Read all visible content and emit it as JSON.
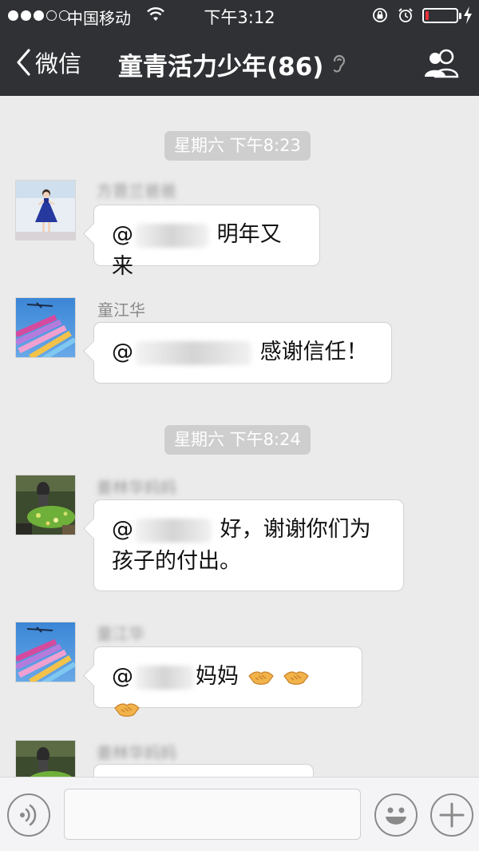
{
  "status_bar": {
    "carrier": "中国移动",
    "time": "下午3:12",
    "signal_bars_filled": 3,
    "signal_bars_total": 5,
    "battery_level": 0.1,
    "icons": [
      "wifi-icon",
      "rotation-lock-icon",
      "alarm-icon",
      "battery-icon",
      "charging-icon"
    ]
  },
  "nav": {
    "back_label": "微信",
    "title": "童青活力少年(86)",
    "ear_icon": "earpiece-mode-icon",
    "members_icon": "group-members-icon"
  },
  "chat": {
    "timestamps": [
      "星期六 下午8:23",
      "星期六 下午8:24"
    ],
    "messages": [
      {
        "sender": "方晋兰爸爸",
        "sender_obscured": true,
        "mention": "@童江华",
        "mention_obscured": true,
        "text": " 明年又来",
        "avatar": "girl-blue-dress-avatar"
      },
      {
        "sender": "童江华",
        "sender_obscured": false,
        "mention": "@方晋兰爸爸",
        "mention_obscured": true,
        "text": " 感谢信任！",
        "avatar": "airshow-jets-avatar"
      },
      {
        "sender": "姜林华妈妈",
        "sender_obscured": true,
        "mention": "@童江华",
        "mention_obscured": true,
        "text": " 好，谢谢你们为孩子的付出。",
        "avatar": "garden-statue-avatar"
      },
      {
        "sender": "童江华",
        "sender_obscured": true,
        "mention": "@姜林华",
        "mention_obscured": true,
        "text": "妈妈",
        "emoji": [
          "handshake-emoji",
          "handshake-emoji",
          "handshake-emoji"
        ],
        "avatar": "airshow-jets-avatar"
      },
      {
        "sender": "姜林华妈妈",
        "sender_obscured": true,
        "avatar": "garden-statue-avatar"
      }
    ]
  },
  "input_bar": {
    "voice_icon": "voice-input-icon",
    "emoji_icon": "emoji-icon",
    "plus_icon": "plus-icon",
    "text_value": ""
  },
  "colors": {
    "nav_background": "#2f3135",
    "chat_background": "#ebebeb",
    "bubble_background": "#ffffff",
    "timestamp_background": "#cecece",
    "battery_low": "#e8333a"
  }
}
